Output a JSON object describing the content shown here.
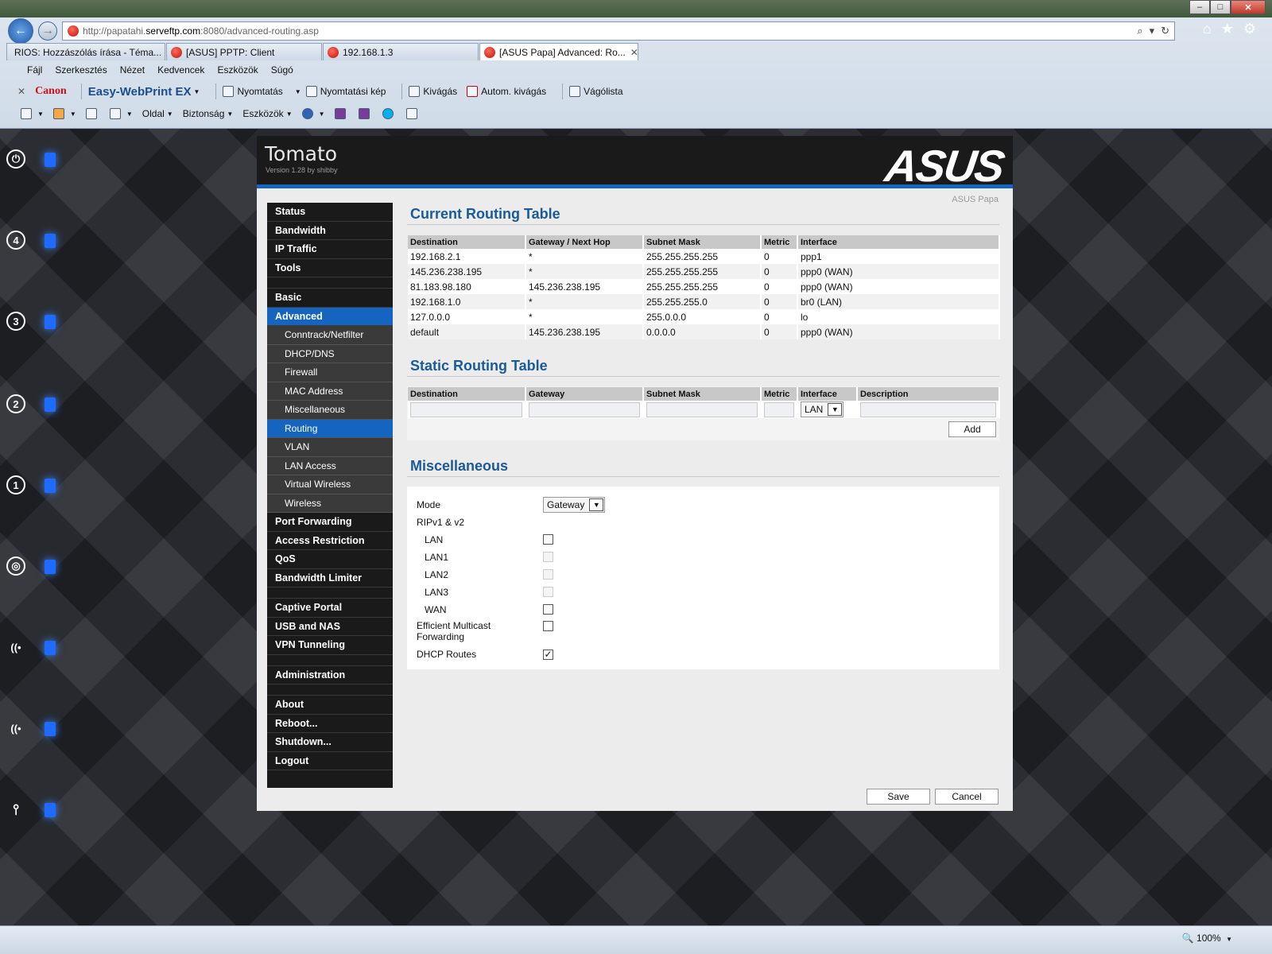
{
  "browser": {
    "url_prefix": "http://papatahi.",
    "url_host": "serveftp.com",
    "url_suffix": ":8080/advanced-routing.asp",
    "tabs": [
      {
        "label": "RIOS: Hozzászólás írása - Téma..."
      },
      {
        "label": "[ASUS] PPTP: Client"
      },
      {
        "label": "192.168.1.3"
      },
      {
        "label": "[ASUS Papa] Advanced: Ro...",
        "active": true
      }
    ],
    "menu": [
      "Fájl",
      "Szerkesztés",
      "Nézet",
      "Kedvencek",
      "Eszközök",
      "Súgó"
    ],
    "toolbar1": {
      "canon": "Canon",
      "ewp": "Easy-WebPrint EX",
      "print": "Nyomtatás",
      "print_preview": "Nyomtatási kép",
      "clip": "Kivágás",
      "auto_clip": "Autom. kivágás",
      "clip_list": "Vágólista"
    },
    "toolbar2": {
      "page": "Oldal",
      "security": "Biztonság",
      "tools": "Eszközök"
    },
    "zoom": "100%"
  },
  "app": {
    "title": "Tomato",
    "version": "Version 1.28 by shibby",
    "brand": "ASUS",
    "router_name": "ASUS Papa"
  },
  "nav": [
    {
      "label": "Status",
      "type": "main"
    },
    {
      "label": "Bandwidth",
      "type": "main"
    },
    {
      "label": "IP Traffic",
      "type": "main"
    },
    {
      "label": "Tools",
      "type": "main"
    },
    {
      "type": "spacer"
    },
    {
      "label": "Basic",
      "type": "main"
    },
    {
      "label": "Advanced",
      "type": "main",
      "active": true
    },
    {
      "label": "Conntrack/Netfilter",
      "type": "sub"
    },
    {
      "label": "DHCP/DNS",
      "type": "sub"
    },
    {
      "label": "Firewall",
      "type": "sub"
    },
    {
      "label": "MAC Address",
      "type": "sub"
    },
    {
      "label": "Miscellaneous",
      "type": "sub"
    },
    {
      "label": "Routing",
      "type": "sub",
      "active": true
    },
    {
      "label": "VLAN",
      "type": "sub"
    },
    {
      "label": "LAN Access",
      "type": "sub"
    },
    {
      "label": "Virtual Wireless",
      "type": "sub"
    },
    {
      "label": "Wireless",
      "type": "sub"
    },
    {
      "label": "Port Forwarding",
      "type": "main"
    },
    {
      "label": "Access Restriction",
      "type": "main"
    },
    {
      "label": "QoS",
      "type": "main"
    },
    {
      "label": "Bandwidth Limiter",
      "type": "main"
    },
    {
      "type": "spacer"
    },
    {
      "label": "Captive Portal",
      "type": "main"
    },
    {
      "label": "USB and NAS",
      "type": "main"
    },
    {
      "label": "VPN Tunneling",
      "type": "main"
    },
    {
      "type": "spacer"
    },
    {
      "label": "Administration",
      "type": "main"
    },
    {
      "type": "spacer"
    },
    {
      "label": "About",
      "type": "main"
    },
    {
      "label": "Reboot...",
      "type": "main"
    },
    {
      "label": "Shutdown...",
      "type": "main"
    },
    {
      "label": "Logout",
      "type": "main"
    }
  ],
  "current_routing": {
    "title": "Current Routing Table",
    "headers": [
      "Destination",
      "Gateway / Next Hop",
      "Subnet Mask",
      "Metric",
      "Interface"
    ],
    "rows": [
      [
        "192.168.2.1",
        "*",
        "255.255.255.255",
        "0",
        "ppp1"
      ],
      [
        "145.236.238.195",
        "*",
        "255.255.255.255",
        "0",
        "ppp0 (WAN)"
      ],
      [
        "81.183.98.180",
        "145.236.238.195",
        "255.255.255.255",
        "0",
        "ppp0 (WAN)"
      ],
      [
        "192.168.1.0",
        "*",
        "255.255.255.0",
        "0",
        "br0 (LAN)"
      ],
      [
        "127.0.0.0",
        "*",
        "255.0.0.0",
        "0",
        "lo"
      ],
      [
        "default",
        "145.236.238.195",
        "0.0.0.0",
        "0",
        "ppp0 (WAN)"
      ]
    ]
  },
  "static_routing": {
    "title": "Static Routing Table",
    "headers": [
      "Destination",
      "Gateway",
      "Subnet Mask",
      "Metric",
      "Interface",
      "Description"
    ],
    "interface_value": "LAN",
    "add_label": "Add"
  },
  "misc": {
    "title": "Miscellaneous",
    "mode_label": "Mode",
    "mode_value": "Gateway",
    "rip_label": "RIPv1 & v2",
    "rip": [
      {
        "label": "LAN",
        "checked": false,
        "disabled": false
      },
      {
        "label": "LAN1",
        "checked": false,
        "disabled": true
      },
      {
        "label": "LAN2",
        "checked": false,
        "disabled": true
      },
      {
        "label": "LAN3",
        "checked": false,
        "disabled": true
      },
      {
        "label": "WAN",
        "checked": false,
        "disabled": false
      }
    ],
    "emf_label_1": "Efficient Multicast",
    "emf_label_2": "Forwarding",
    "emf_checked": false,
    "dhcp_routes_label": "DHCP Routes",
    "dhcp_routes_checked": true
  },
  "footer": {
    "save": "Save",
    "cancel": "Cancel"
  },
  "colors": {
    "accent": "#1565c0",
    "section_title": "#1a5a96",
    "sidebar": "#1a1a1a",
    "led": "#1f6bff"
  },
  "leds": [
    {
      "icon": "power-icon"
    },
    {
      "icon": "port-4-icon"
    },
    {
      "icon": "port-3-icon"
    },
    {
      "icon": "port-2-icon"
    },
    {
      "icon": "port-1-icon"
    },
    {
      "icon": "wan-globe-icon"
    },
    {
      "icon": "wifi-5ghz-icon"
    },
    {
      "icon": "wifi-2ghz-icon"
    },
    {
      "icon": "usb-icon"
    }
  ]
}
